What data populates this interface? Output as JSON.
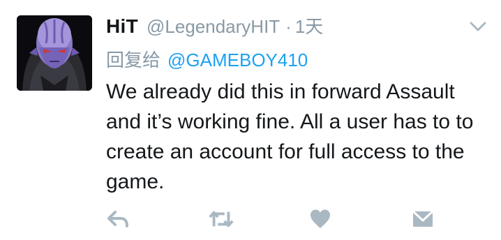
{
  "tweet": {
    "display_name": "HiT",
    "handle": "@LegendaryHIT",
    "separator": "·",
    "time": "1天",
    "reply_prefix": "回复给",
    "reply_to": "@GAMEBOY410",
    "text": "We already did this in forward Assault and it’s working fine. All a user has to to create an account for full access to the game."
  },
  "icons": {
    "menu": "chevron-down-icon",
    "reply": "reply-icon",
    "retweet": "retweet-icon",
    "like": "heart-icon",
    "message": "envelope-icon"
  },
  "colors": {
    "text": "#14171a",
    "secondary": "#8899a6",
    "link": "#1da1f2",
    "action_icon": "#aab8c2"
  }
}
